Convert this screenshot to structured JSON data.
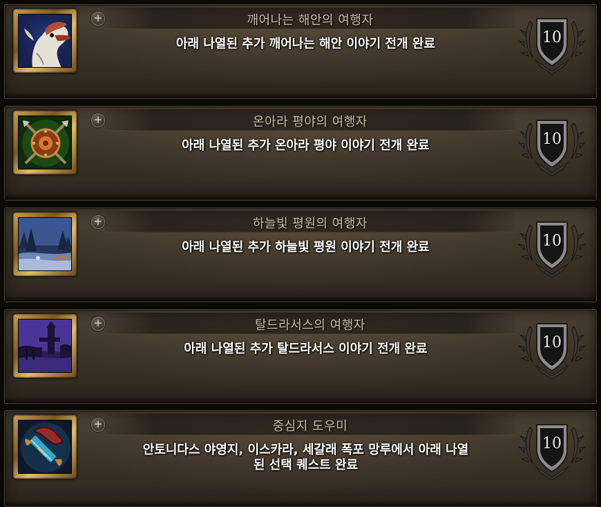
{
  "achievements": [
    {
      "title": "깨어나는 해안의 여행자",
      "description": "아래 나열된 추가 깨어나는 해안 이야기 전개 완료",
      "points": "10",
      "icon": "dragon-portrait-icon",
      "expand_label": "+"
    },
    {
      "title": "온아라 평야의 여행자",
      "description": "아래 나열된 추가 온아라 평야 이야기 전개 완료",
      "points": "10",
      "icon": "centaur-shield-icon",
      "expand_label": "+"
    },
    {
      "title": "하늘빛 평원의 여행자",
      "description": "아래 나열된 추가 하늘빛 평원 이야기 전개 완료",
      "points": "10",
      "icon": "blue-forest-landscape-icon",
      "expand_label": "+"
    },
    {
      "title": "탈드라서스의 여행자",
      "description": "아래 나열된 추가 탈드라서스 이야기 전개 완료",
      "points": "10",
      "icon": "purple-tower-landscape-icon",
      "expand_label": "+"
    },
    {
      "title": "중심지 도우미",
      "description": "안토니다스 야영지, 이스카라, 세갈래 폭포 망루에서 아래 나열\n된 선택 퀘스트 완료",
      "points": "10",
      "icon": "rolled-scroll-icon",
      "expand_label": "+"
    }
  ]
}
